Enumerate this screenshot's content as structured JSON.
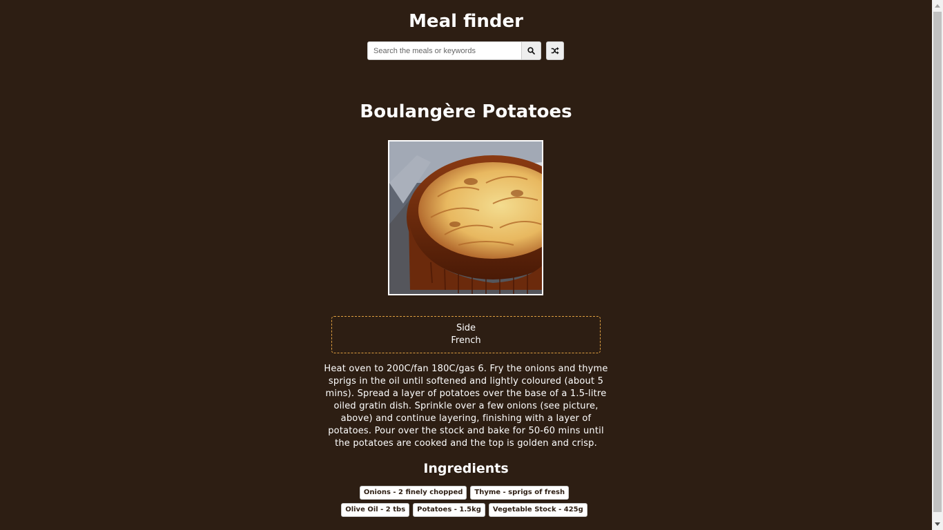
{
  "header": {
    "title": "Meal finder",
    "search": {
      "placeholder": "Search the meals or keywords",
      "value": ""
    },
    "search_icon": "search-icon",
    "random_icon": "shuffle-icon"
  },
  "meal": {
    "title": "Boulangère Potatoes",
    "category": "Side",
    "area": "French",
    "instructions": "Heat oven to 200C/fan 180C/gas 6. Fry the onions and thyme sprigs in the oil until softened and lightly coloured (about 5 mins). Spread a layer of potatoes over the base of a 1.5-litre oiled gratin dish. Sprinkle over a few onions (see picture, above) and continue layering, finishing with a layer of potatoes. Pour over the stock and bake for 50-60 mins until the potatoes are cooked and the top is golden and crisp.",
    "ingredients_title": "Ingredients",
    "ingredients": [
      "Onions - 2 finely chopped",
      "Thyme - sprigs of fresh",
      "Olive Oil - 2 tbs",
      "Potatoes - 1.5kg",
      "Vegetable Stock - 425g"
    ]
  },
  "colors": {
    "background": "#2d1e13",
    "info_border": "#e0a040"
  }
}
